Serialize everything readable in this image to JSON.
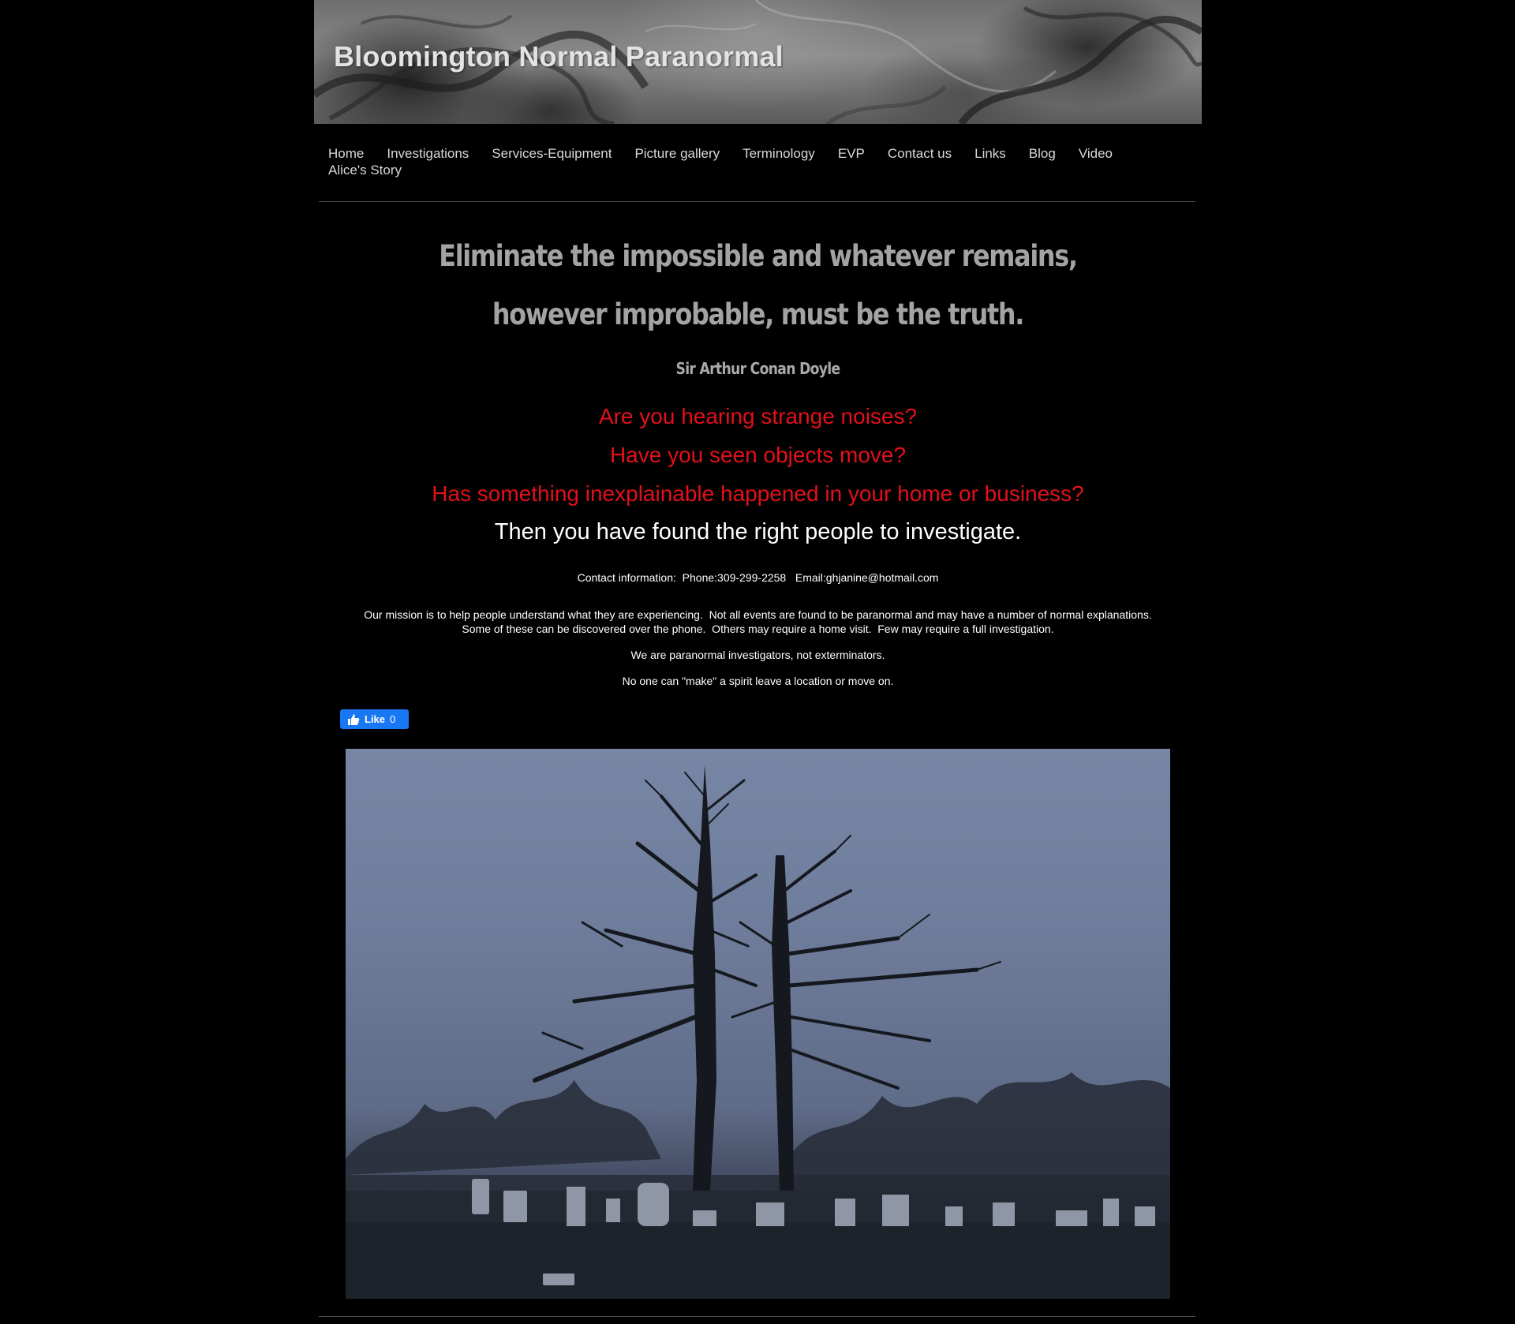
{
  "site": {
    "title": "Bloomington Normal Paranormal"
  },
  "nav": {
    "items": [
      {
        "label": "Home",
        "name": "nav-home"
      },
      {
        "label": "Investigations",
        "name": "nav-investigations"
      },
      {
        "label": "Services-Equipment",
        "name": "nav-services-equipment"
      },
      {
        "label": "Picture gallery",
        "name": "nav-picture-gallery"
      },
      {
        "label": "Terminology",
        "name": "nav-terminology"
      },
      {
        "label": "EVP",
        "name": "nav-evp"
      },
      {
        "label": "Contact us",
        "name": "nav-contact-us"
      },
      {
        "label": "Links",
        "name": "nav-links"
      },
      {
        "label": "Blog",
        "name": "nav-blog"
      },
      {
        "label": "Video",
        "name": "nav-video"
      },
      {
        "label": "Alice's Story",
        "name": "nav-alices-story"
      }
    ]
  },
  "quote": {
    "line1": "Eliminate the impossible and whatever remains,",
    "line2": "however improbable, must be the truth.",
    "author": "Sir Arthur Conan Doyle"
  },
  "questions": {
    "q1": "Are you hearing strange noises?",
    "q2": "Have you seen objects move?",
    "q3": "Has something inexplainable happened in your home or business?",
    "answer": "Then you have found the right people to investigate."
  },
  "contact": {
    "text": "Contact information:  Phone:309-299-2258   Email:ghjanine@hotmail.com"
  },
  "mission": {
    "line1": "Our mission is to help people understand what they are experiencing.  Not all events are found to be paranormal and may have a number of normal explanations.",
    "line2": "Some of these can be discovered over the phone.  Others may require a home visit.  Few may require a full investigation.",
    "line3": "We are paranormal investigators, not exterminators.",
    "line4": "No one can \"make\" a spirit leave a location or move on."
  },
  "like_button": {
    "label": "Like",
    "count": "0",
    "icon": "thumbs-up-icon"
  },
  "colors": {
    "background": "#000000",
    "question_red": "#e3101a",
    "quote_gray": "#a3a3a3",
    "like_blue": "#1877f2"
  }
}
